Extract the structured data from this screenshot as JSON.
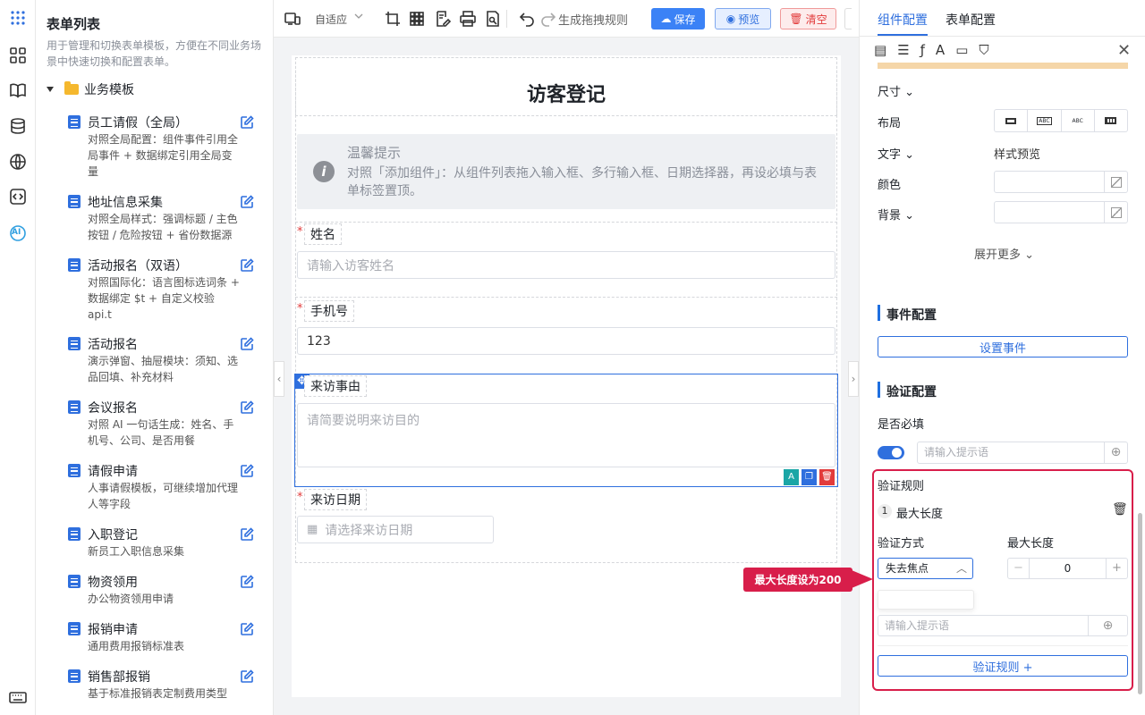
{
  "sidebar": {
    "title": "表单列表",
    "description": "用于管理和切换表单模板，方便在不同业务场景中快速切换和配置表单。",
    "folder": "业务模板",
    "items": [
      {
        "name": "员工请假（全局）",
        "desc": "对照全局配置：组件事件引用全局事件 + 数据绑定引用全局变量"
      },
      {
        "name": "地址信息采集",
        "desc": "对照全局样式：强调标题 / 主色按钮 / 危险按钮 + 省份数据源"
      },
      {
        "name": "活动报名（双语）",
        "desc": "对照国际化：语言图标选词条 + 数据绑定 $t + 自定义校验 api.t"
      },
      {
        "name": "活动报名",
        "desc": "演示弹窗、抽屉模块：须知、选品回填、补充材料"
      },
      {
        "name": "会议报名",
        "desc": "对照 AI 一句话生成：姓名、手机号、公司、是否用餐"
      },
      {
        "name": "请假申请",
        "desc": "人事请假模板，可继续增加代理人等字段"
      },
      {
        "name": "入职登记",
        "desc": "新员工入职信息采集"
      },
      {
        "name": "物资领用",
        "desc": "办公物资领用申请"
      },
      {
        "name": "报销申请",
        "desc": "通用费用报销标准表"
      },
      {
        "name": "销售部报销",
        "desc": "基于标准报销表定制费用类型"
      }
    ]
  },
  "toolbar": {
    "device_select": "自适应",
    "generate_rule": "生成拖拽规则",
    "save": "保存",
    "preview": "预览",
    "clear": "清空"
  },
  "form": {
    "title": "访客登记",
    "tip_title": "温馨提示",
    "tip_body": "对照「添加组件」：从组件列表拖入输入框、多行输入框、日期选择器，再设必填与表单标签置顶。",
    "fields": [
      {
        "label": "姓名",
        "placeholder": "请输入访客姓名",
        "value": ""
      },
      {
        "label": "手机号",
        "placeholder": "",
        "value": "123"
      },
      {
        "label": "来访事由",
        "placeholder": "请简要说明来访目的",
        "value": ""
      },
      {
        "label": "来访日期",
        "placeholder": "请选择来访日期",
        "value": ""
      }
    ]
  },
  "panel": {
    "tabs": [
      "组件配置",
      "表单配置"
    ],
    "size_label": "尺寸",
    "layout_label": "布局",
    "layout_options": [
      "ABC",
      "ABC"
    ],
    "text_label": "文字",
    "style_preview": "样式预览",
    "color_label": "颜色",
    "bg_label": "背景",
    "expand_more": "展开更多",
    "event_section": "事件配置",
    "set_event": "设置事件",
    "validation_section": "验证配置",
    "required_label": "是否必填",
    "prompt_placeholder": "请输入提示语",
    "rules_title": "验证规则",
    "rule_index": "1",
    "rule_name": "最大长度",
    "trigger_label": "验证方式",
    "maxlen_label": "最大长度",
    "trigger_value": "失去焦点",
    "maxlen_value": "0",
    "rule_prompt_placeholder": "请输入提示语",
    "add_rule": "验证规则 +"
  },
  "annotation": "最大长度设为200",
  "colors": {
    "primary": "#2f6fde",
    "danger": "#e23b3b",
    "annotation": "#d81e4a",
    "folder": "#f5b82e"
  }
}
